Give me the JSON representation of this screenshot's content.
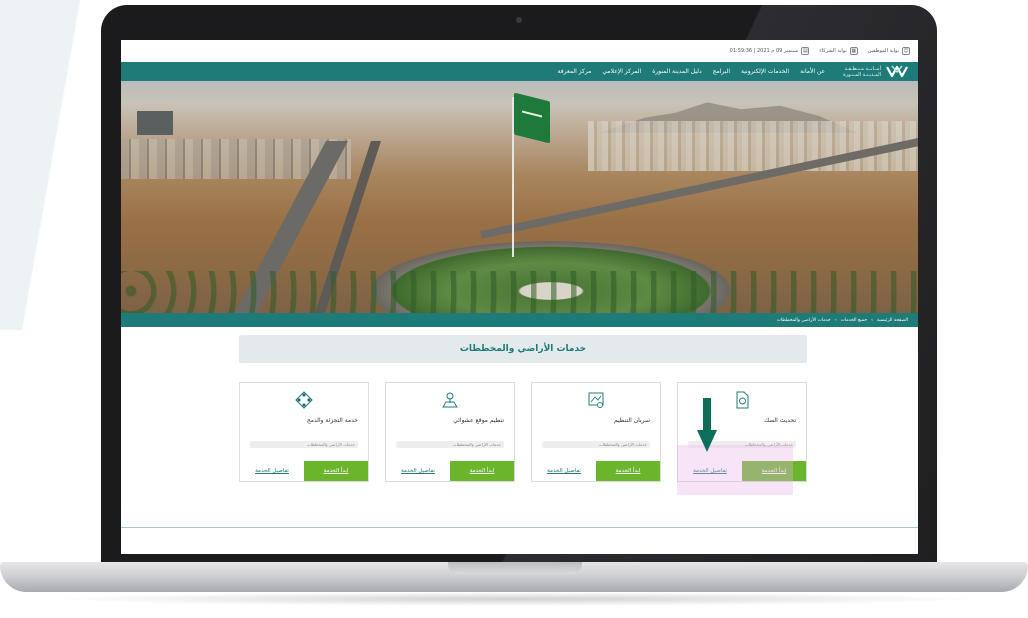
{
  "topbar": {
    "datetime": "01:59:36 | 2021 سبتمبر 09 م",
    "partners_portal": "بوابة الشركاء",
    "employees_portal": "بوابة الموظفين"
  },
  "brand": {
    "line1": "أمــانــة مـنـطـقـة",
    "line2": "المـديـنـة المـنـورة"
  },
  "nav": {
    "items": [
      "عن الأمانة",
      "الخدمات الإلكترونية",
      "البرامج",
      "دليل المدينة المنورة",
      "المركز الإعلامي",
      "مركز المعرفة"
    ]
  },
  "breadcrumb": {
    "items": [
      "الصفحة الرئيسية",
      "جميع الخدمات",
      "خدمات الأراضي والمخططات"
    ],
    "separator": "›"
  },
  "page": {
    "title": "خدمات الأراضي والمخططات"
  },
  "cards": [
    {
      "title": "تحديث الصك",
      "tag": "خدمات الأراضي والمخططات",
      "start": "ابدأ الخدمة",
      "details": "تفاصيل الخدمة",
      "icon": "document-icon"
    },
    {
      "title": "سريان التنظيم",
      "tag": "خدمات الأراضي والمخططات",
      "start": "ابدأ الخدمة",
      "details": "تفاصيل الخدمة",
      "icon": "map-document-icon"
    },
    {
      "title": "تنظيم موقع عشوائي",
      "tag": "خدمات الأراضي والمخططات",
      "start": "ابدأ الخدمة",
      "details": "تفاصيل الخدمة",
      "icon": "location-pin-icon"
    },
    {
      "title": "خدمة التجزئة والدمج",
      "tag": "خدمات الأراضي والمخططات",
      "start": "ابدأ الخدمة",
      "details": "تفاصيل الخدمة",
      "icon": "split-merge-icon"
    }
  ],
  "colors": {
    "brand_teal": "#1e7b77",
    "start_green": "#6bb52d",
    "arrow_green": "#0f6e5a",
    "highlight": "#e8b3e6"
  }
}
